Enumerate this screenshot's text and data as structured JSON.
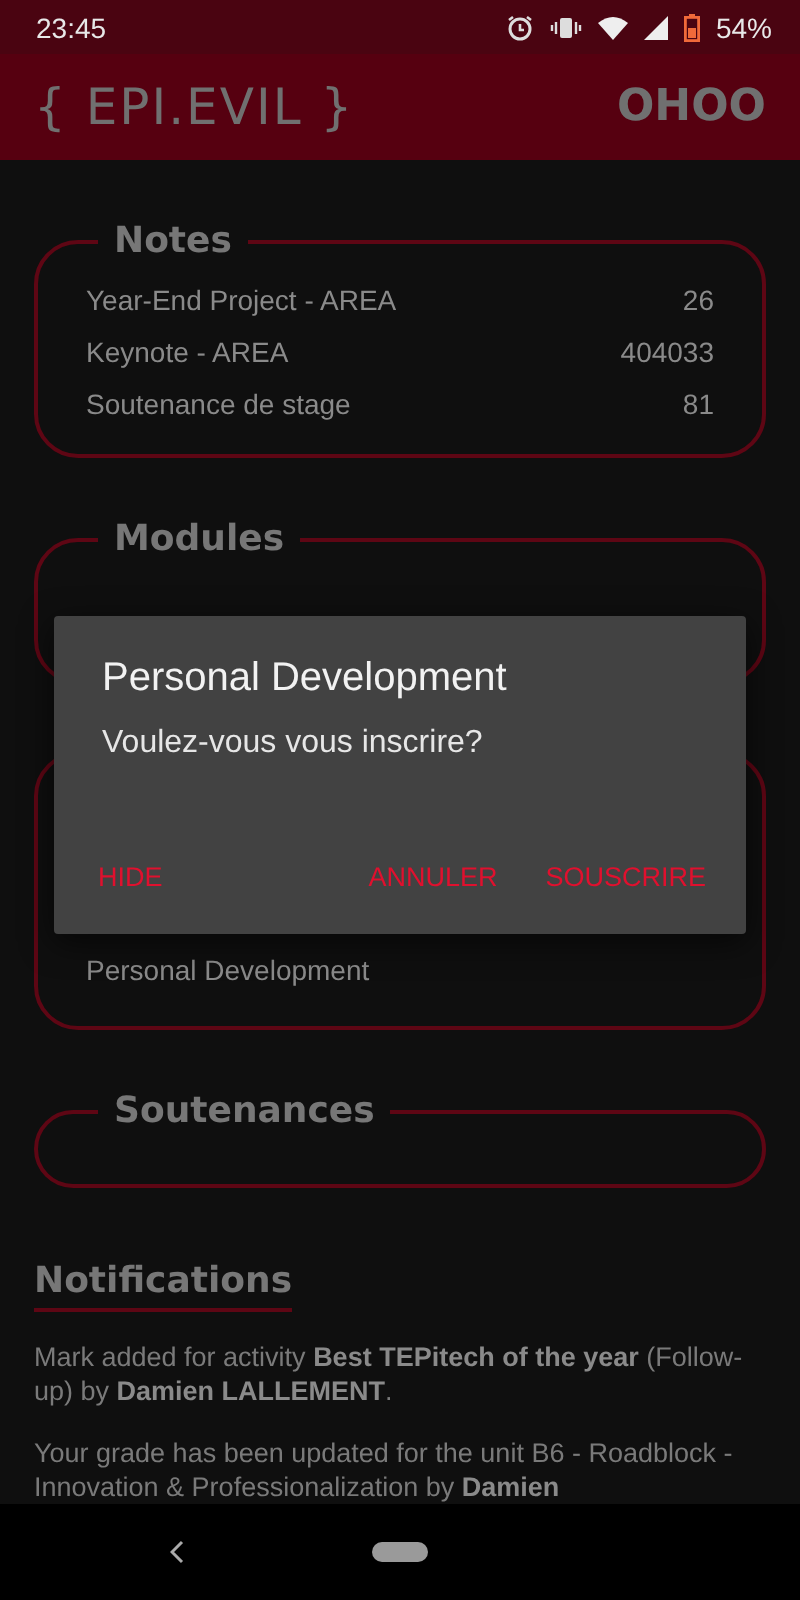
{
  "status_bar": {
    "time": "23:45",
    "battery": "54%"
  },
  "app_bar": {
    "logo": "{ EPI.EVIL }",
    "user": "OHOO"
  },
  "cards": [
    {
      "kind": "titled",
      "title": "Notes",
      "rows": [
        {
          "label": "Year-End Project - AREA",
          "value": "26"
        },
        {
          "label": "Keynote - AREA",
          "value": "404033"
        },
        {
          "label": "Soutenance de stage",
          "value": "81"
        }
      ]
    },
    {
      "kind": "covered",
      "title": "Modules"
    },
    {
      "kind": "untitled",
      "rows": [
        {
          "label": "Personal Development"
        }
      ]
    },
    {
      "kind": "titled",
      "title": "Soutenances"
    }
  ],
  "notifications": {
    "title": "Notifications",
    "items": [
      "Mark added for activity **Best TEPitech of the year** (Follow-up) by **Damien LALLEMENT**.",
      "Your grade has been updated for the unit B6 - Roadblock - Innovation & Professionalization by **Damien**"
    ]
  },
  "dialog": {
    "title": "Personal Development",
    "message": "Voulez-vous vous inscrire?",
    "buttons": [
      {
        "label": "HIDE",
        "kind": "left"
      },
      {
        "label": "ANNULER",
        "kind": "right"
      },
      {
        "label": "SOUSCRIRE",
        "kind": "right"
      }
    ]
  }
}
